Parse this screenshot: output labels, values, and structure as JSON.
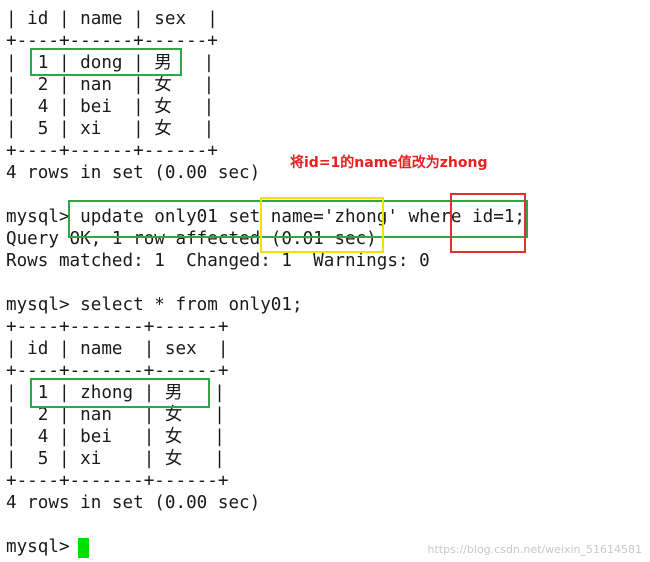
{
  "terminal": {
    "lines": [
      "| id | name | sex  |",
      "+----+------+------+",
      "|  1 | dong | 男   |",
      "|  2 | nan  | 女   |",
      "|  4 | bei  | 女   |",
      "|  5 | xi   | 女   |",
      "+----+------+------+",
      "4 rows in set (0.00 sec)",
      "",
      "mysql> update only01 set name='zhong' where id=1;",
      "Query OK, 1 row affected (0.01 sec)",
      "Rows matched: 1  Changed: 1  Warnings: 0",
      "",
      "mysql> select * from only01;",
      "+----+-------+------+",
      "| id | name  | sex  |",
      "+----+-------+------+",
      "|  1 | zhong | 男   |",
      "|  2 | nan   | 女   |",
      "|  4 | bei   | 女   |",
      "|  5 | xi    | 女   |",
      "+----+-------+------+",
      "4 rows in set (0.00 sec)",
      "",
      "mysql> "
    ]
  },
  "annotation": {
    "note": "将id=1的name值改为zhong",
    "colors": {
      "green": "#2aa84a",
      "yellow": "#f2e000",
      "red": "#e03030"
    }
  },
  "watermark": "https://blog.csdn.net/weixin_51614581",
  "cursor_color": "#00e000"
}
